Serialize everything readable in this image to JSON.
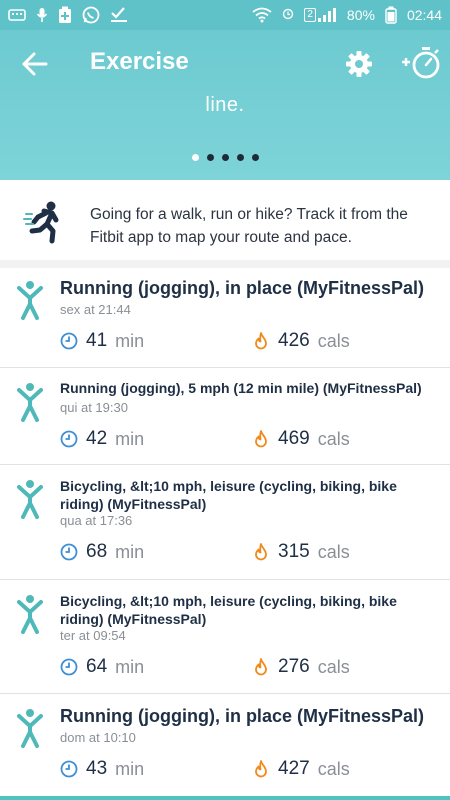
{
  "status_bar": {
    "battery_percent": "80%",
    "time": "02:44",
    "sim_badge": "2"
  },
  "header": {
    "title": "Exercise",
    "carousel_text": "line.",
    "carousel_pages": 5,
    "carousel_active_index": 0
  },
  "promo": {
    "text": "Going for a walk, run or hike? Track it from the Fitbit app to map your route and pace."
  },
  "exercises": [
    {
      "name": "Running (jogging), in place (MyFitnessPal)",
      "when": "sex at 21:44",
      "duration": "41",
      "duration_unit": "min",
      "calories": "426",
      "calories_unit": "cals"
    },
    {
      "name": "Running (jogging), 5 mph (12 min mile) (MyFitnessPal)",
      "when": "qui at 19:30",
      "duration": "42",
      "duration_unit": "min",
      "calories": "469",
      "calories_unit": "cals"
    },
    {
      "name": "Bicycling, &lt;10 mph, leisure (cycling, biking, bike riding) (MyFitnessPal)",
      "when": "qua at 17:36",
      "duration": "68",
      "duration_unit": "min",
      "calories": "315",
      "calories_unit": "cals"
    },
    {
      "name": "Bicycling, &lt;10 mph, leisure (cycling, biking, bike riding) (MyFitnessPal)",
      "when": "ter at 09:54",
      "duration": "64",
      "duration_unit": "min",
      "calories": "276",
      "calories_unit": "cals"
    },
    {
      "name": "Running (jogging), in place (MyFitnessPal)",
      "when": "dom at 10:10",
      "duration": "43",
      "duration_unit": "min",
      "calories": "427",
      "calories_unit": "cals"
    }
  ],
  "colors": {
    "header": "#6ccad0",
    "teal_icon": "#4fb8b8",
    "clock": "#3d8fd6",
    "flame": "#f08a1c",
    "title_text": "#1f2f45"
  }
}
